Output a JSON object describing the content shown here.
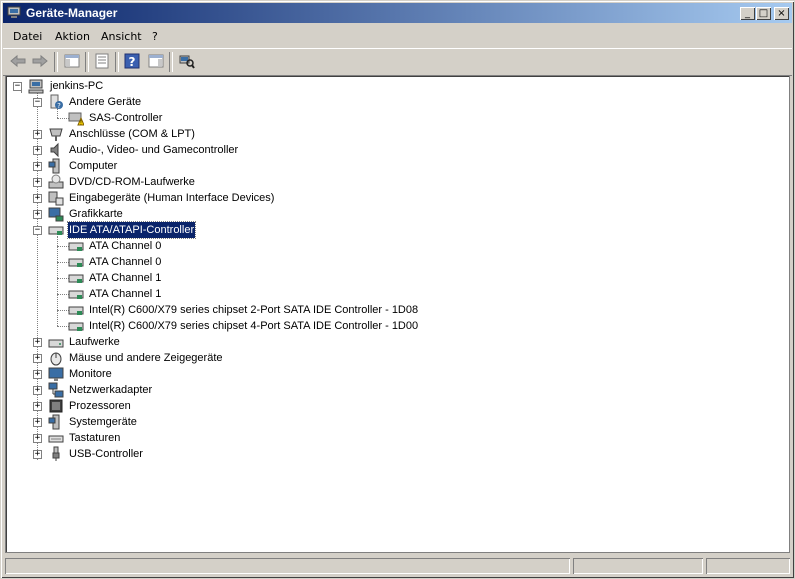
{
  "window": {
    "title": "Geräte-Manager"
  },
  "menu": [
    {
      "label": "Datei"
    },
    {
      "label": "Aktion"
    },
    {
      "label": "Ansicht"
    },
    {
      "label": "?"
    }
  ],
  "tree": {
    "root": "jenkins-PC",
    "items": [
      {
        "label": "Andere Geräte"
      },
      {
        "label": "SAS-Controller"
      },
      {
        "label": "Anschlüsse (COM & LPT)"
      },
      {
        "label": "Audio-, Video- und Gamecontroller"
      },
      {
        "label": "Computer"
      },
      {
        "label": "DVD/CD-ROM-Laufwerke"
      },
      {
        "label": "Eingabegeräte (Human Interface Devices)"
      },
      {
        "label": "Grafikkarte"
      },
      {
        "label": "IDE ATA/ATAPI-Controller"
      },
      {
        "label": "ATA Channel 0"
      },
      {
        "label": "ATA Channel 0"
      },
      {
        "label": "ATA Channel 1"
      },
      {
        "label": "ATA Channel 1"
      },
      {
        "label": "Intel(R) C600/X79 series chipset 2-Port SATA IDE Controller - 1D08"
      },
      {
        "label": "Intel(R) C600/X79 series chipset 4-Port SATA IDE Controller - 1D00"
      },
      {
        "label": "Laufwerke"
      },
      {
        "label": "Mäuse und andere Zeigegeräte"
      },
      {
        "label": "Monitore"
      },
      {
        "label": "Netzwerkadapter"
      },
      {
        "label": "Prozessoren"
      },
      {
        "label": "Systemgeräte"
      },
      {
        "label": "Tastaturen"
      },
      {
        "label": "USB-Controller"
      }
    ]
  }
}
